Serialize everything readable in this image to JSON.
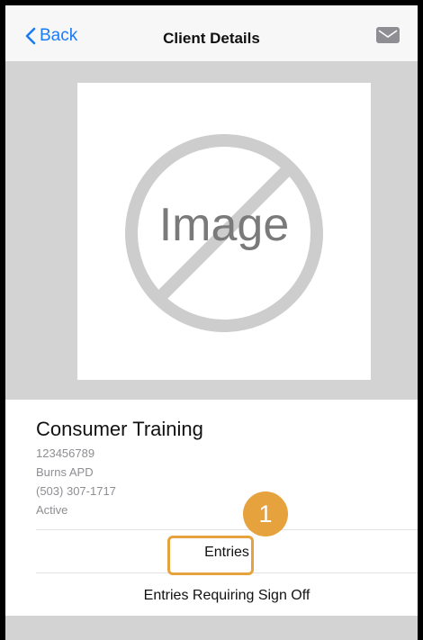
{
  "navbar": {
    "back_label": "Back",
    "title": "Client Details"
  },
  "image_placeholder": {
    "text": "Image"
  },
  "client": {
    "name": "Consumer Training",
    "id": "123456789",
    "agency": "Burns APD",
    "phone": "(503) 307-1717",
    "status": "Active"
  },
  "actions": {
    "entries": "Entries",
    "entries_signoff": "Entries Requiring Sign Off"
  },
  "callout": {
    "number": "1",
    "color": "#e6a23c"
  },
  "colors": {
    "accent": "#1a7cf5",
    "mail_icon": "#8e8e93"
  }
}
